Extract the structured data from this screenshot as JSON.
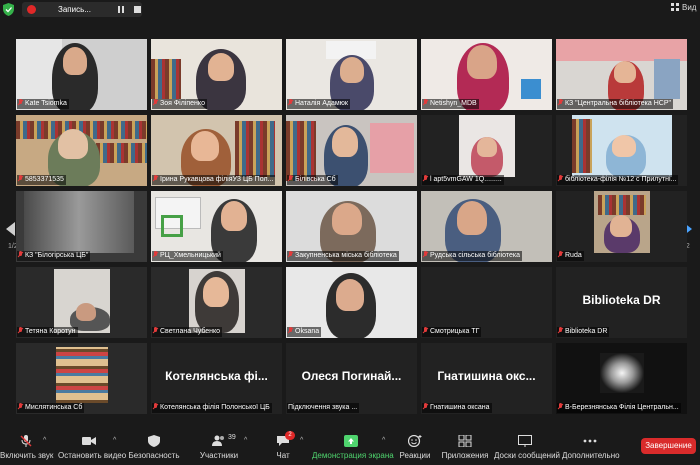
{
  "top": {
    "recording_label": "Запись...",
    "view_label": "Вид"
  },
  "pagination": {
    "left": "1/2",
    "right": "1/2"
  },
  "tiles": [
    {
      "name": "Kate   Tsiomka",
      "muted": true
    },
    {
      "name": "Зоя Філіпенко",
      "muted": true
    },
    {
      "name": "Наталія Адамюк",
      "muted": true
    },
    {
      "name": "Netishyn_MDB",
      "muted": true
    },
    {
      "name": "КЗ \"Центральна бібліотека НСР\"",
      "muted": true
    },
    {
      "name": "5853371535",
      "muted": true
    },
    {
      "name": "Ірина Рукавцова філіяУЗ ЦБ Пол...",
      "muted": true
    },
    {
      "name": "Білівська Сб",
      "muted": true
    },
    {
      "name": "l apt5vmGAW 1Q.........",
      "muted": true
    },
    {
      "name": "бібліотека-філія №12 с Прилутні...",
      "muted": true
    },
    {
      "name": "КЗ \"Білогірська ЦБ\"",
      "muted": true
    },
    {
      "name": "РЦ_Хмельницький",
      "muted": true
    },
    {
      "name": "Закупненська міська бібліотека",
      "muted": true
    },
    {
      "name": "Рудська сільська бібліотека",
      "muted": true
    },
    {
      "name": "Ruda",
      "muted": true
    },
    {
      "name": "Тетяна Коротун",
      "muted": true
    },
    {
      "name": "Светлана Чубенко",
      "muted": true
    },
    {
      "name": "Oksana",
      "muted": true
    },
    {
      "name": "Смотрицька ТГ",
      "muted": true
    },
    {
      "name": "Biblioteka DR",
      "muted": true,
      "big": "Biblioteka DR"
    },
    {
      "name": "Мислятинська Сб",
      "muted": true
    },
    {
      "name": "Котелянська філія Полонської ЦБ",
      "muted": true,
      "big": "Котелянська фі..."
    },
    {
      "name": "Підключення звука ...",
      "muted": false,
      "big": "Олеся Погинай..."
    },
    {
      "name": "Гнатишина оксана",
      "muted": true,
      "big": "Гнатишина окс..."
    },
    {
      "name": "В-Березнянська Філія Центральн...",
      "muted": true
    }
  ],
  "toolbar": {
    "audio": "Включить звук",
    "video": "Остановить видео",
    "security": "Безопасность",
    "participants": "Участники",
    "participants_count": "39",
    "chat": "Чат",
    "chat_badge": "2",
    "share": "Демонстрация экрана",
    "reactions": "Реакции",
    "apps": "Приложения",
    "whiteboard": "Доски сообщений",
    "more": "Дополнительно",
    "end": "Завершение"
  },
  "colors": {
    "background": "#1a1a1a",
    "active_speaker": "#d7e05a",
    "end_button": "#d92b2b",
    "share_green": "#4fd46e",
    "muted_red": "#e23b3b"
  }
}
